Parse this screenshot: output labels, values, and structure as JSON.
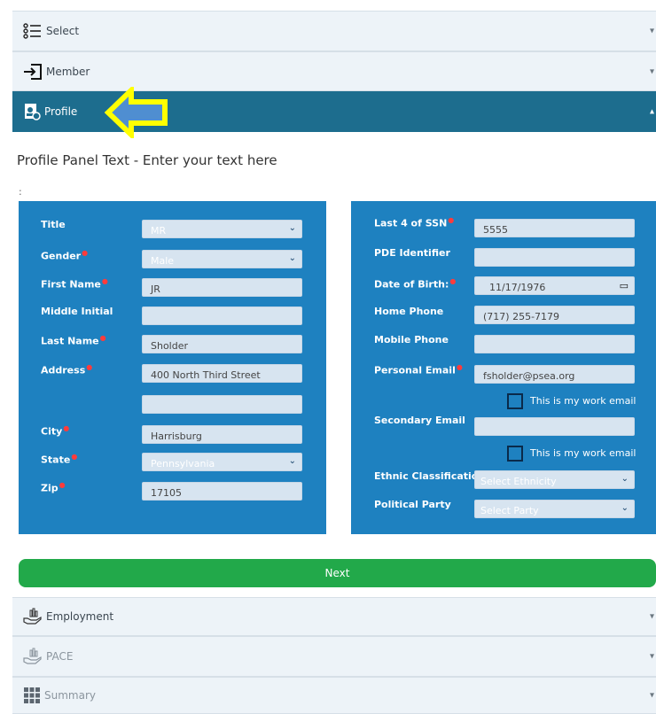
{
  "accordion": {
    "select": {
      "label": "Select"
    },
    "member": {
      "label": "Member"
    },
    "profile": {
      "label": "Profile"
    },
    "employment": {
      "label": "Employment"
    },
    "pace": {
      "label": "PACE"
    },
    "summary": {
      "label": "Summary"
    }
  },
  "profile": {
    "heading": "Profile Panel Text - Enter your text here",
    "colon": ":",
    "left": {
      "title": {
        "label": "Title",
        "value": "MR"
      },
      "gender": {
        "label": "Gender",
        "value": "Male"
      },
      "first_name": {
        "label": "First Name",
        "value": "JR"
      },
      "middle_initial": {
        "label": "Middle Initial",
        "value": ""
      },
      "last_name": {
        "label": "Last Name",
        "value": "Sholder"
      },
      "address": {
        "label": "Address",
        "value": "400 North Third Street",
        "value2": ""
      },
      "city": {
        "label": "City",
        "value": "Harrisburg"
      },
      "state": {
        "label": "State",
        "value": "Pennsylvania"
      },
      "zip": {
        "label": "Zip",
        "value": "17105"
      }
    },
    "right": {
      "ssn": {
        "label": "Last 4 of SSN",
        "value": "5555"
      },
      "pde": {
        "label": "PDE Identifier",
        "value": ""
      },
      "dob": {
        "label": "Date of Birth:",
        "value": "11/17/1976"
      },
      "home_phone": {
        "label": "Home Phone",
        "value": "(717) 255-7179"
      },
      "mobile_phone": {
        "label": "Mobile Phone",
        "value": ""
      },
      "personal_email": {
        "label": "Personal Email",
        "value": "fsholder@psea.org",
        "work_label": "This is my work email"
      },
      "secondary_email": {
        "label": "Secondary Email",
        "value": "",
        "work_label": "This is my work email"
      },
      "ethnic": {
        "label": "Ethnic Classification",
        "value": "Select Ethnicity"
      },
      "party": {
        "label": "Political Party",
        "value": "Select Party"
      }
    },
    "next_label": "Next"
  },
  "colors": {
    "active_header": "#1d6d8e",
    "panel": "#1e81c0",
    "next": "#22a94a",
    "callout_arrow": "#ffff00"
  }
}
